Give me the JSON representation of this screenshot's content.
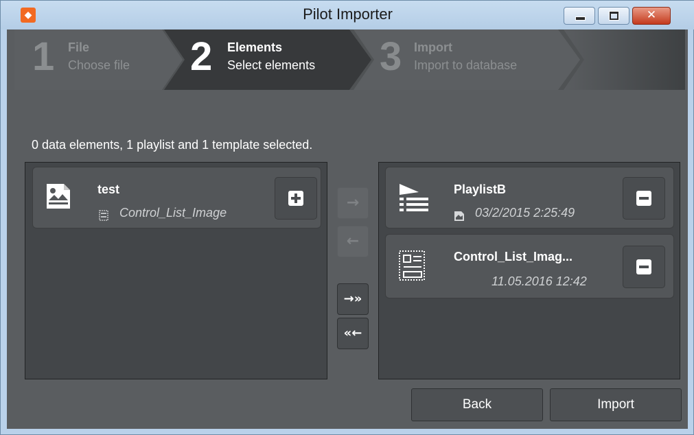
{
  "window": {
    "title": "Pilot Importer"
  },
  "steps": [
    {
      "number": "1",
      "title": "File",
      "subtitle": "Choose file"
    },
    {
      "number": "2",
      "title": "Elements",
      "subtitle": "Select elements"
    },
    {
      "number": "3",
      "title": "Import",
      "subtitle": "Import to database"
    }
  ],
  "status_text": "0 data elements, 1 playlist and 1 template selected.",
  "available_items": [
    {
      "name": "test",
      "subtitle": "Control_List_Image",
      "icon": "image-document-icon"
    }
  ],
  "selected_items": [
    {
      "name": "PlaylistB",
      "subtitle": "03/2/2015 2:25:49",
      "icon": "playlist-icon"
    },
    {
      "name": "Control_List_Imag...",
      "subtitle": "11.05.2016 12:42",
      "icon": "template-icon"
    }
  ],
  "transfer_buttons": {
    "move_right": "→",
    "move_left": "←",
    "move_all_right": "→»",
    "move_all_left": "«←"
  },
  "buttons": {
    "back": "Back",
    "import": "Import"
  },
  "colors": {
    "app_icon": "#f26a22",
    "active_step": "#37393b",
    "panel": "#434649"
  }
}
